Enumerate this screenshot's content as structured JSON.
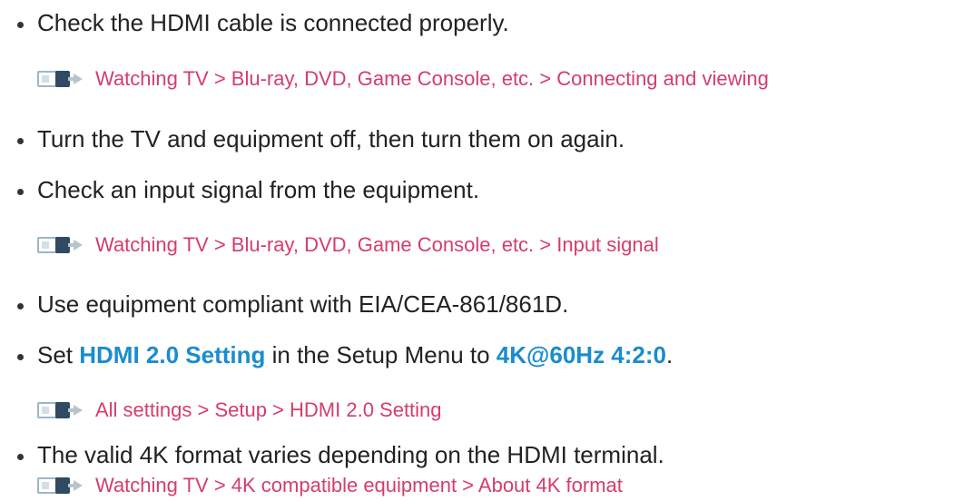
{
  "items": [
    {
      "kind": "bullet",
      "text": "Check the HDMI cable is connected properly."
    },
    {
      "kind": "link",
      "text": "Watching TV > Blu-ray, DVD, Game Console, etc. > Connecting and viewing"
    },
    {
      "kind": "bullet",
      "text": "Turn the TV and equipment off, then turn them on again."
    },
    {
      "kind": "bullet",
      "text": "Check an input signal from the equipment."
    },
    {
      "kind": "link",
      "text": "Watching TV > Blu-ray, DVD, Game Console, etc. > Input signal"
    },
    {
      "kind": "bullet",
      "text": "Use equipment compliant with EIA/CEA-861/861D."
    },
    {
      "kind": "bullet",
      "parts": {
        "pre": "Set ",
        "hl1": "HDMI 2.0 Setting",
        "mid": " in the Setup Menu to ",
        "hl2": "4K@60Hz 4:2:0",
        "post": "."
      }
    },
    {
      "kind": "link",
      "text": "All settings > Setup > HDMI 2.0 Setting"
    },
    {
      "kind": "bullet",
      "text": "The valid 4K format varies depending on the HDMI terminal."
    },
    {
      "kind": "link",
      "text": "Watching TV > 4K compatible equipment > About 4K format"
    }
  ],
  "icon": "menu-navigation-icon"
}
